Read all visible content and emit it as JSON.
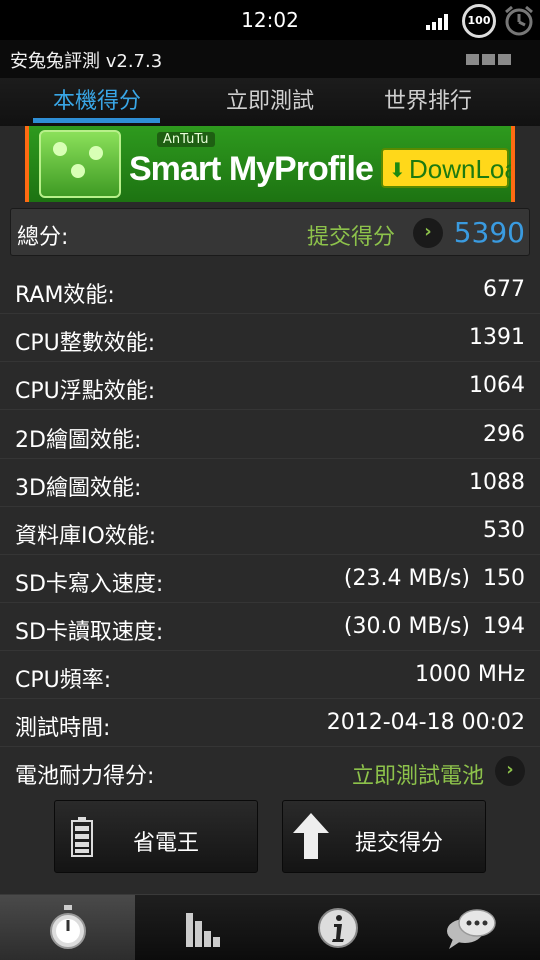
{
  "status_bar": {
    "time": "12:02",
    "battery_level": "100",
    "icons": [
      "signal-icon",
      "battery-icon",
      "alarm-icon"
    ]
  },
  "app": {
    "title": "安兔兔評測 v2.7.3"
  },
  "tabs": [
    {
      "label": "本機得分",
      "active": true
    },
    {
      "label": "立即測試",
      "active": false
    },
    {
      "label": "世界排行",
      "active": false
    }
  ],
  "banner": {
    "small_text": "AnTuTu",
    "title": "Smart MyProfile",
    "download_label": "DownLoad"
  },
  "total": {
    "label": "總分:",
    "submit_label": "提交得分",
    "score": "5390"
  },
  "results": [
    {
      "label": "RAM效能:",
      "value": "677"
    },
    {
      "label": "CPU整數效能:",
      "value": "1391"
    },
    {
      "label": "CPU浮點效能:",
      "value": "1064"
    },
    {
      "label": "2D繪圖效能:",
      "value": "296"
    },
    {
      "label": "3D繪圖效能:",
      "value": "1088"
    },
    {
      "label": "資料庫IO效能:",
      "value": "530"
    },
    {
      "label": "SD卡寫入速度:",
      "speed": "(23.4 MB/s)",
      "value": "150"
    },
    {
      "label": "SD卡讀取速度:",
      "speed": "(30.0 MB/s)",
      "value": "194"
    },
    {
      "label": "CPU頻率:",
      "value": "1000 MHz"
    },
    {
      "label": "測試時間:",
      "value": "2012-04-18 00:02"
    },
    {
      "label": "電池耐力得分:",
      "link": "立即測試電池"
    }
  ],
  "actions": {
    "power_saver_label": "省電王",
    "submit_label": "提交得分"
  },
  "bottom_nav": [
    {
      "icon": "stopwatch-icon",
      "active": true
    },
    {
      "icon": "bar-chart-icon",
      "active": false
    },
    {
      "icon": "info-icon",
      "active": false
    },
    {
      "icon": "chat-bubble-icon",
      "active": false
    }
  ],
  "colors": {
    "accent_blue": "#39a6e6",
    "link_green": "#8dc24b",
    "banner_green": "#2e9a1e",
    "banner_orange": "#ff6b12"
  }
}
